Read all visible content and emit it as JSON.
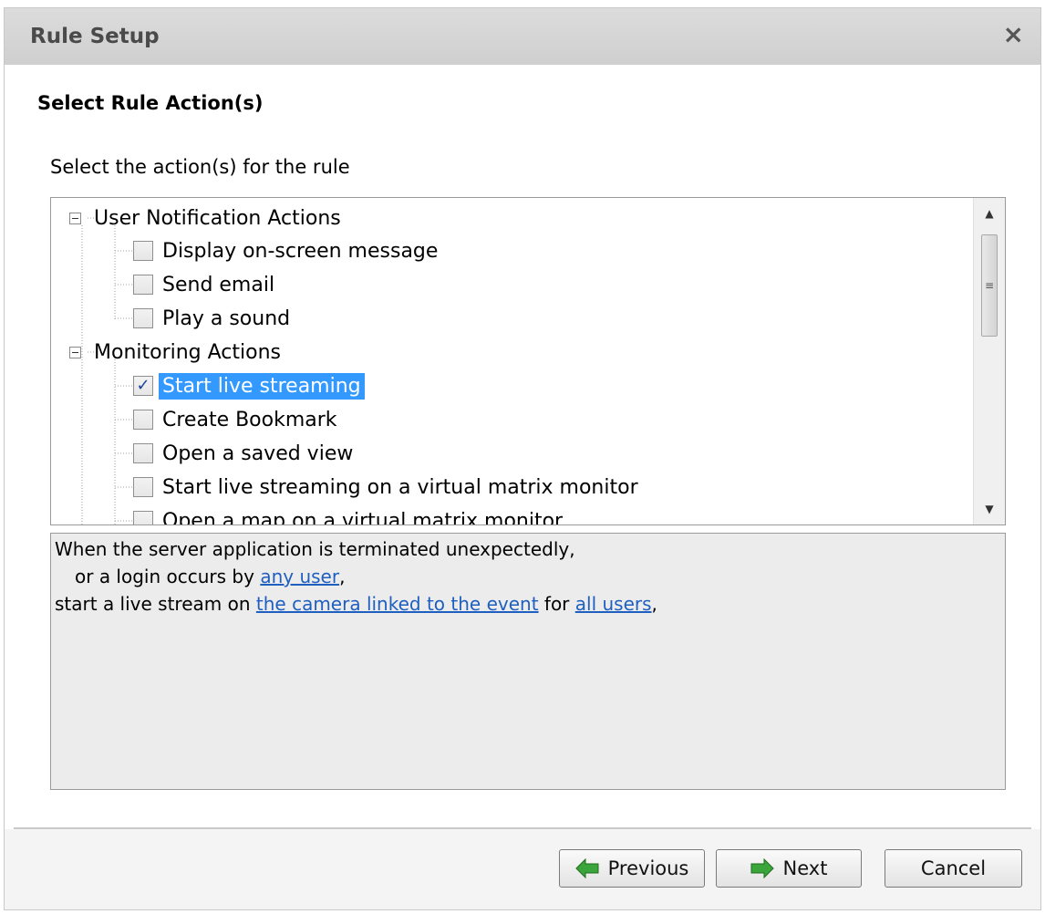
{
  "dialog": {
    "title": "Rule Setup",
    "close_glyph": "×"
  },
  "page": {
    "heading": "Select Rule Action(s)",
    "instruction": "Select the action(s) for the rule"
  },
  "tree": {
    "groups": [
      {
        "label": "User Notification Actions",
        "items": [
          {
            "label": "Display on-screen message",
            "checked": false
          },
          {
            "label": "Send email",
            "checked": false
          },
          {
            "label": "Play a sound",
            "checked": false
          }
        ]
      },
      {
        "label": "Monitoring Actions",
        "items": [
          {
            "label": "Start live streaming",
            "checked": true,
            "selected": true
          },
          {
            "label": "Create Bookmark",
            "checked": false
          },
          {
            "label": "Open a saved view",
            "checked": false
          },
          {
            "label": "Start live streaming on a virtual matrix monitor",
            "checked": false
          },
          {
            "label": "Open a map on a virtual matrix monitor",
            "checked": false
          }
        ]
      }
    ],
    "check_glyph": "✓",
    "expander_glyph": "−",
    "scroll_up_glyph": "▲",
    "scroll_down_glyph": "▼",
    "scroll_thumb_glyph": "≡"
  },
  "description": {
    "line1": "When the server application is terminated unexpectedly,",
    "line2_prefix": "or a login occurs by ",
    "line2_link": "any user",
    "line2_suffix": ",",
    "line3_prefix": "start a live stream on ",
    "line3_link1": "the camera linked to the event",
    "line3_mid": " for ",
    "line3_link2": "all users",
    "line3_suffix": ","
  },
  "buttons": {
    "previous": "Previous",
    "next": "Next",
    "cancel": "Cancel"
  },
  "colors": {
    "selection": "#3399ff",
    "link": "#1f5fbf",
    "arrow_green": "#3aa53a"
  }
}
